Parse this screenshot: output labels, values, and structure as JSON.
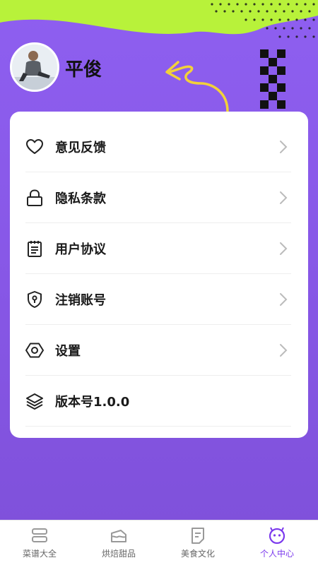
{
  "profile": {
    "name": "平俊"
  },
  "menu": [
    {
      "label": "意见反馈",
      "icon": "heart-icon"
    },
    {
      "label": "隐私条款",
      "icon": "lock-icon"
    },
    {
      "label": "用户协议",
      "icon": "notepad-icon"
    },
    {
      "label": "注销账号",
      "icon": "shield-key-icon"
    },
    {
      "label": "设置",
      "icon": "hexagon-settings-icon"
    },
    {
      "label": "版本号1.0.0",
      "icon": "layers-icon"
    }
  ],
  "tabs": [
    {
      "label": "菜谱大全",
      "icon": "recipe-icon",
      "active": false
    },
    {
      "label": "烘焙甜品",
      "icon": "cake-icon",
      "active": false
    },
    {
      "label": "美食文化",
      "icon": "note-icon",
      "active": false
    },
    {
      "label": "个人中心",
      "icon": "smiley-icon",
      "active": true
    }
  ],
  "colors": {
    "background": "#8757e6",
    "lime": "#b8f23a",
    "accent_arrow": "#f2d13a",
    "tab_active": "#7c3aed"
  }
}
